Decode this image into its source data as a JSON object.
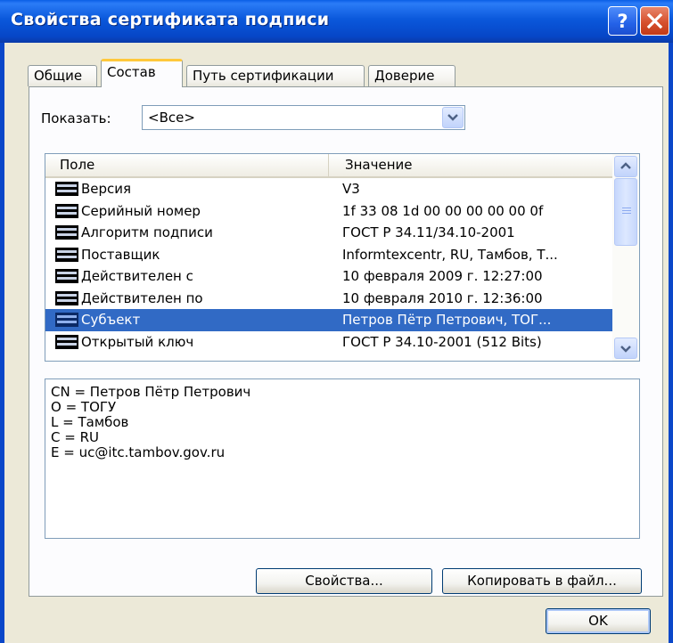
{
  "window": {
    "title": "Свойства сертификата подписи"
  },
  "titlebar_buttons": {
    "help": "help-icon",
    "close": "close-icon"
  },
  "tabs": [
    {
      "label": "Общие",
      "active": false
    },
    {
      "label": "Состав",
      "active": true
    },
    {
      "label": "Путь сертификации",
      "active": false
    },
    {
      "label": "Доверие",
      "active": false
    }
  ],
  "show": {
    "label": "Показать:",
    "value": "<Все>"
  },
  "list": {
    "columns": [
      "Поле",
      "Значение"
    ],
    "rows": [
      {
        "field": "Версия",
        "value": "V3",
        "selected": false
      },
      {
        "field": "Серийный номер",
        "value": "1f 33 08 1d 00 00 00 00 00 0f",
        "selected": false
      },
      {
        "field": "Алгоритм подписи",
        "value": "ГОСТ Р 34.11/34.10-2001",
        "selected": false
      },
      {
        "field": "Поставщик",
        "value": "Informtexcentr, RU, Тамбов, Т...",
        "selected": false
      },
      {
        "field": "Действителен с",
        "value": "10 февраля 2009 г. 12:27:00",
        "selected": false
      },
      {
        "field": "Действителен по",
        "value": "10 февраля 2010 г. 12:36:00",
        "selected": false
      },
      {
        "field": "Субъект",
        "value": "Петров Пётр Петрович, ТОГ...",
        "selected": true
      },
      {
        "field": "Открытый ключ",
        "value": "ГОСТ Р 34.10-2001 (512 Bits)",
        "selected": false
      }
    ]
  },
  "details": {
    "lines": [
      "CN = Петров Пётр Петрович",
      "O = ТОГУ",
      "L = Тамбов",
      "C = RU",
      "E = uc@itc.tambov.gov.ru"
    ]
  },
  "buttons": {
    "properties": "Свойства...",
    "copy_to_file": "Копировать в файл...",
    "ok": "OK"
  },
  "colors": {
    "title_bar": "#0a58db",
    "selection": "#316ac5",
    "active_tab_accent": "#ffc83c",
    "dialog_face": "#ece9d8"
  }
}
